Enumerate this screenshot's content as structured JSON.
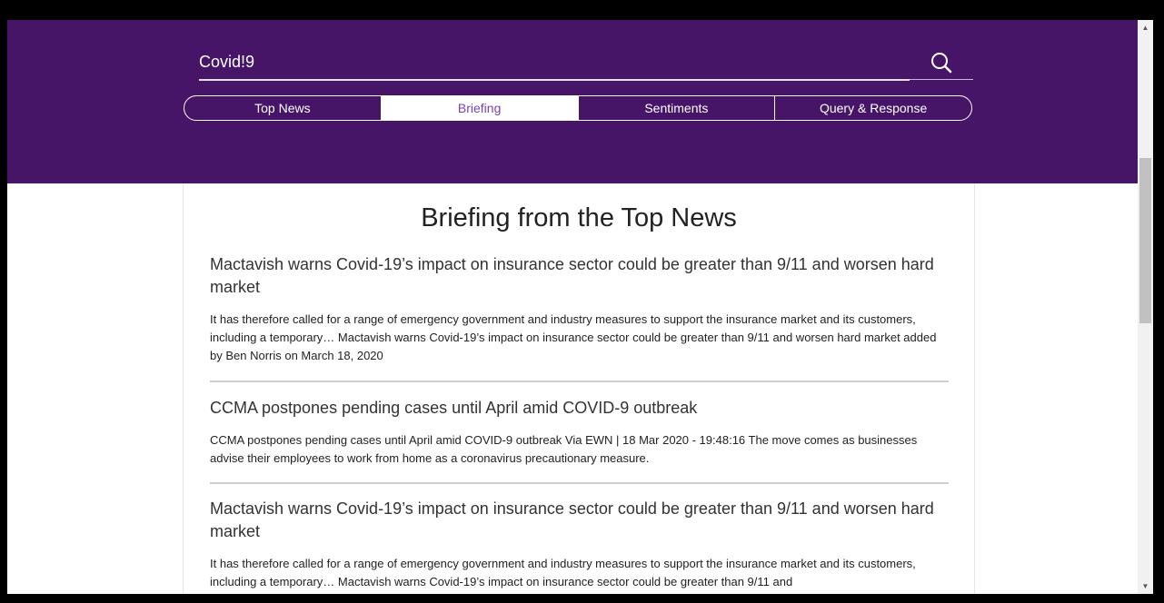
{
  "search": {
    "value": "Covid!9",
    "icon": "search-icon"
  },
  "tabs": [
    {
      "label": "Top News"
    },
    {
      "label": "Briefing"
    },
    {
      "label": "Sentiments"
    },
    {
      "label": "Query & Response"
    }
  ],
  "active_tab": "Briefing",
  "page_title": "Briefing from the Top News",
  "articles": [
    {
      "headline": "Mactavish warns Covid-19’s impact on insurance sector could be greater than 9/11 and worsen hard market",
      "body": "It has therefore called for a range of emergency government and industry measures to support the insurance market and its customers, including a temporary… Mactavish warns Covid-19’s impact on insurance sector could be greater than 9/11 and worsen hard market added by Ben Norris on March 18, 2020"
    },
    {
      "headline": "CCMA postpones pending cases until April amid COVID-9 outbreak",
      "body": "CCMA postpones pending cases until April amid COVID-9 outbreak Via EWN | 18 Mar 2020 - 19:48:16 The move comes as businesses advise their employees to work from home as a coronavirus precautionary measure."
    },
    {
      "headline": "Mactavish warns Covid-19’s impact on insurance sector could be greater than 9/11 and worsen hard market",
      "body": "It has therefore called for a range of emergency government and industry measures to support the insurance market and its customers, including a temporary… Mactavish warns Covid-19’s impact on insurance sector could be greater than 9/11 and"
    }
  ],
  "colors": {
    "header_bg": "#461567",
    "active_tab_text": "#7a42b0"
  }
}
